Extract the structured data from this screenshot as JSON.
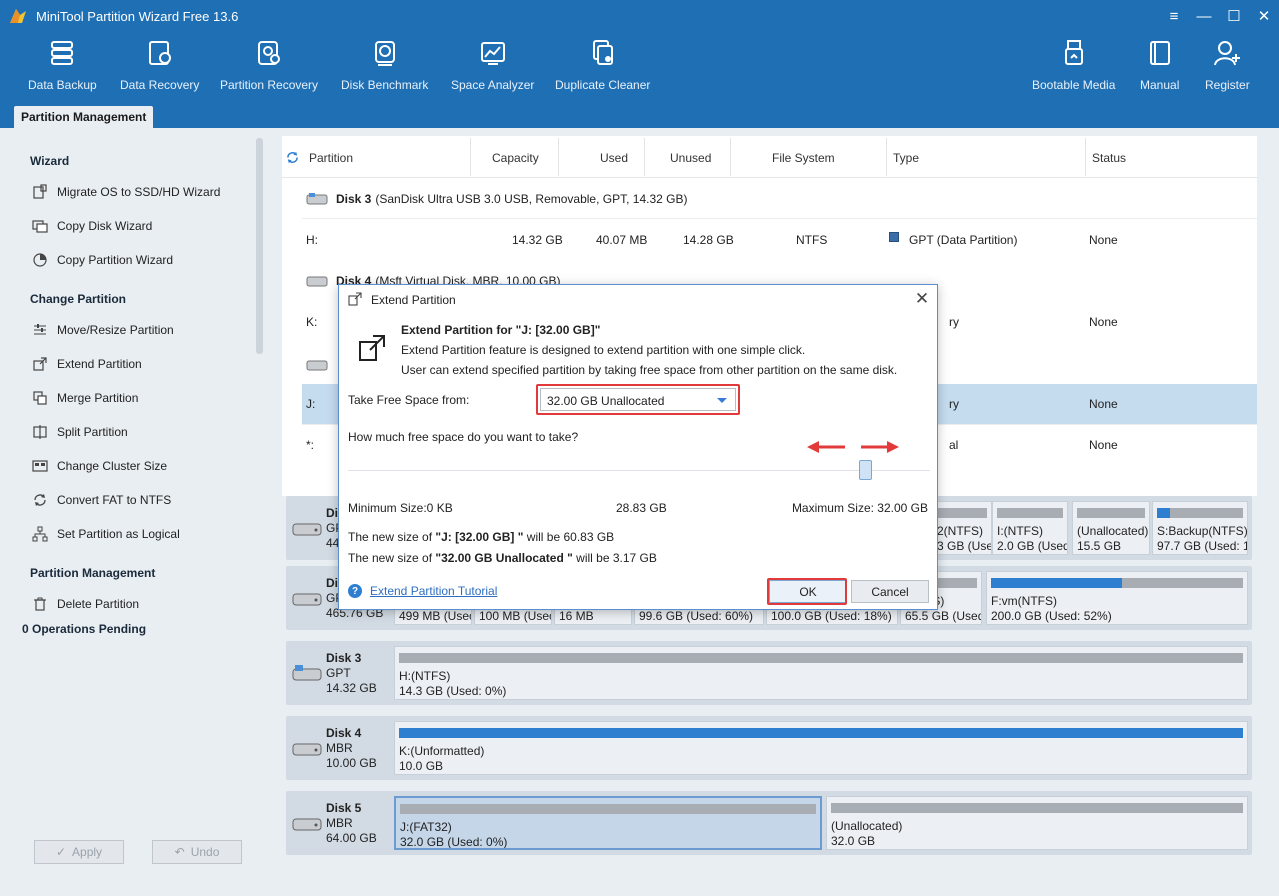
{
  "window": {
    "title": "MiniTool Partition Wizard Free 13.6"
  },
  "toolbar": {
    "items": [
      {
        "label": "Data Backup",
        "icon": "data-backup-icon"
      },
      {
        "label": "Data Recovery",
        "icon": "data-recovery-icon"
      },
      {
        "label": "Partition Recovery",
        "icon": "partition-recovery-icon"
      },
      {
        "label": "Disk Benchmark",
        "icon": "disk-benchmark-icon"
      },
      {
        "label": "Space Analyzer",
        "icon": "space-analyzer-icon"
      },
      {
        "label": "Duplicate Cleaner",
        "icon": "duplicate-cleaner-icon"
      },
      {
        "label": "Bootable Media",
        "icon": "bootable-media-icon"
      },
      {
        "label": "Manual",
        "icon": "manual-icon"
      },
      {
        "label": "Register",
        "icon": "register-icon"
      }
    ]
  },
  "tab": {
    "label": "Partition Management"
  },
  "sidebar": {
    "wizard": {
      "title": "Wizard",
      "items": [
        "Migrate OS to SSD/HD Wizard",
        "Copy Disk Wizard",
        "Copy Partition Wizard"
      ]
    },
    "change": {
      "title": "Change Partition",
      "items": [
        "Move/Resize Partition",
        "Extend Partition",
        "Merge Partition",
        "Split Partition",
        "Change Cluster Size",
        "Convert FAT to NTFS",
        "Set Partition as Logical"
      ]
    },
    "manage": {
      "title": "Partition Management",
      "items": [
        "Delete Partition"
      ]
    },
    "pending": "0 Operations Pending",
    "apply": "Apply",
    "undo": "Undo"
  },
  "table": {
    "headers": [
      "Partition",
      "Capacity",
      "Used",
      "Unused",
      "File System",
      "Type",
      "Status"
    ],
    "disk3": {
      "name": "Disk 3",
      "desc": "(SanDisk Ultra USB 3.0 USB, Removable, GPT, 14.32 GB)"
    },
    "disk4": {
      "name": "Disk 4",
      "desc": "(Msft Virtual Disk, MBR, 10.00 GB)"
    },
    "rows": {
      "h": {
        "partition": "H:",
        "capacity": "14.32 GB",
        "used": "40.07 MB",
        "unused": "14.28 GB",
        "fs": "NTFS",
        "type": "GPT (Data Partition)",
        "status": "None"
      },
      "k": {
        "partition": "K:",
        "type": "ry",
        "status": "None"
      },
      "j": {
        "partition": "J:",
        "type": "ry",
        "status": "None"
      },
      "star": {
        "partition": "*:",
        "type": "al",
        "status": "None"
      }
    }
  },
  "diskmap": {
    "d1": {
      "name": "Di",
      "line2": "GP",
      "line3": "44",
      "parts": [
        {
          "l1": "2(NTFS)",
          "l2": "3 GB (Used:",
          "used": 0
        },
        {
          "l1": "I:(NTFS)",
          "l2": "2.0 GB (Used:",
          "used": 0
        },
        {
          "l1": "(Unallocated)",
          "l2": "15.5 GB",
          "used": 0
        },
        {
          "l1": "S:Backup(NTFS)",
          "l2": "97.7 GB (Used: 15'",
          "used": 0.15
        }
      ]
    },
    "d2": {
      "name": "Di",
      "line2": "GP",
      "line3": "465.76 GB",
      "parts": [
        {
          "l2": "499 MB (Usec",
          "used": 0
        },
        {
          "l2": "100 MB (Usec",
          "used": 0
        },
        {
          "l2": "16 MB",
          "used": 0
        },
        {
          "l2": "99.6 GB (Used: 60%)",
          "used": 0.6
        },
        {
          "l2": "100.0 GB (Used: 18%)",
          "used": 0.18
        },
        {
          "l1": "(NTFS)",
          "l2": "65.5 GB (Used:",
          "used": 0
        },
        {
          "l1": "F:vm(NTFS)",
          "l2": "200.0 GB (Used: 52%)",
          "used": 0.52
        }
      ]
    },
    "d3": {
      "name": "Disk 3",
      "type": "GPT",
      "size": "14.32 GB",
      "part": {
        "l1": "H:(NTFS)",
        "l2": "14.3 GB (Used: 0%)",
        "used": 0
      }
    },
    "d4": {
      "name": "Disk 4",
      "type": "MBR",
      "size": "10.00 GB",
      "part": {
        "l1": "K:(Unformatted)",
        "l2": "10.0 GB",
        "used": 1.0
      }
    },
    "d5": {
      "name": "Disk 5",
      "type": "MBR",
      "size": "64.00 GB",
      "parts": [
        {
          "l1": "J:(FAT32)",
          "l2": "32.0 GB (Used: 0%)",
          "used": 0
        },
        {
          "l1": "(Unallocated)",
          "l2": "32.0 GB",
          "used": 0
        }
      ]
    }
  },
  "dialog": {
    "title": "Extend Partition",
    "heading": "Extend Partition for \"J: [32.00 GB]\"",
    "desc1": "Extend Partition feature is designed to extend partition with one simple click.",
    "desc2": "User can extend specified partition by taking free space from other partition on the same disk.",
    "take_label": "Take Free Space from:",
    "take_value": "32.00 GB Unallocated",
    "question": "How much free space do you want to take?",
    "min": "Minimum Size:0 KB",
    "mid": "28.83 GB",
    "max": "Maximum Size: 32.00 GB",
    "new1_pre": "The new size of ",
    "new1_name": "\"J: [32.00 GB] \"",
    "new1_post": " will be 60.83 GB",
    "new2_pre": "The new size of ",
    "new2_name": "\"32.00 GB Unallocated \"",
    "new2_post": " will be 3.17 GB",
    "tutorial": "Extend Partition Tutorial",
    "ok": "OK",
    "cancel": "Cancel",
    "slider_fraction": 0.9
  },
  "colors": {
    "accent": "#1f6fb5",
    "highlight": "#e23a3a",
    "bar": "#2f7fd0"
  }
}
